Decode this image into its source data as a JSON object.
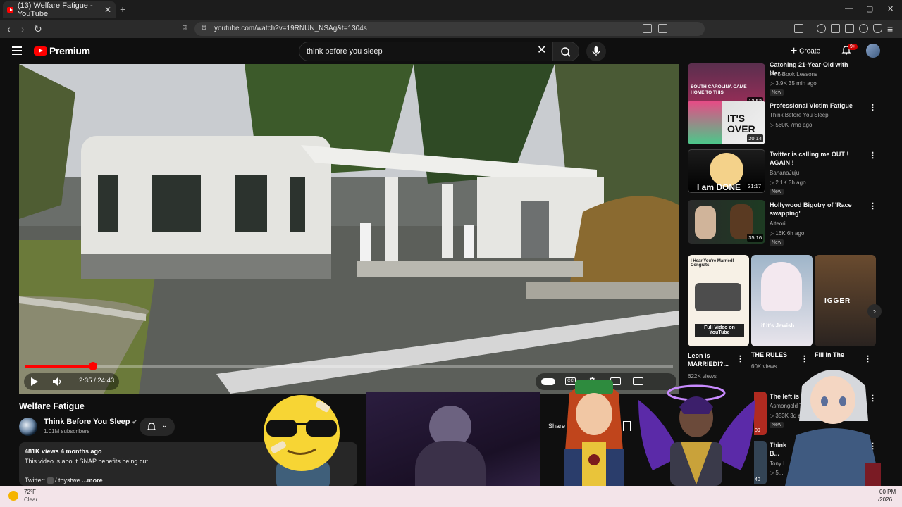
{
  "browser": {
    "tab_title": "(13) Welfare Fatigue - YouTube",
    "tab_close": "✕",
    "new_tab": "+",
    "url": "youtube.com/watch?v=19RNUN_NSAg&t=1304s",
    "window_controls": [
      "—",
      "▢",
      "✕"
    ]
  },
  "youtube_header": {
    "logo_text": "Premium",
    "search_query": "think before you sleep",
    "create_label": "Create",
    "notification_count": "9+"
  },
  "player": {
    "time": "2:35 / 24:43",
    "progress_fraction": 0.105
  },
  "video": {
    "title": "Welfare Fatigue",
    "channel": "Think Before You Sleep",
    "subscribers": "1.01M subscribers",
    "views_line": "481K views  4 months ago",
    "description": "This video is about SNAP benefits being cut.",
    "twitter_line": "Twitter:",
    "twitter_handle": "/ tbystwe",
    "more": "...more"
  },
  "overlay_labels": {
    "share": "Share"
  },
  "sidebar": {
    "videos": [
      {
        "title": "Catching 21-Year-Old with Her...",
        "channel": "Pink Book Lessons",
        "meta": "▷ 3.9K  35 min ago",
        "badge": "New",
        "duration": "12:53",
        "thumb_text": "SOUTH CAROLINA CAME HOME TO THIS"
      },
      {
        "title": "Professional Victim Fatigue",
        "channel": "Think Before You Sleep",
        "meta": "▷ 560K  7mo ago",
        "badge": "",
        "duration": "20:14",
        "thumb_text": "IT'S OVER"
      },
      {
        "title": "Twitter is calling me OUT ! AGAIN !",
        "channel": "BananaJuju",
        "meta": "▷ 2.1K  3h ago",
        "badge": "New",
        "duration": "31:17",
        "thumb_text": "I am DONE"
      },
      {
        "title": "Hollywood Bigotry of 'Race swapping'",
        "channel": "Alteori",
        "meta": "▷ 16K  6h ago",
        "badge": "New",
        "duration": "35:16",
        "thumb_text": ""
      }
    ],
    "shorts": [
      {
        "caption": "Leon is MARRIED!?...",
        "meta": "622K views",
        "thumb_top": "I Hear You're Married! Congrats!",
        "thumb_bottom": "Full Video on YouTube"
      },
      {
        "caption": "THE RULES",
        "meta": "60K views",
        "thumb_top": "",
        "thumb_bottom": "if it's Jewish"
      },
      {
        "caption": "Fill In The",
        "meta": "",
        "thumb_top": "IGGER",
        "thumb_bottom": ""
      }
    ],
    "lower": [
      {
        "title": "The left is ... BROKED...",
        "channel": "Asmongold TV",
        "meta": "▷ 353K  3d ago",
        "badge": "New",
        "duration": "09"
      },
      {
        "title": "Think B... Sams...",
        "channel": "Tony I",
        "meta": "▷ 5...",
        "badge": "",
        "duration": "40"
      }
    ]
  },
  "taskbar": {
    "temperature": "72°F",
    "condition": "Clear",
    "time": "00 PM",
    "date": "/2026"
  },
  "colors": {
    "youtube_red": "#ff0000",
    "bg": "#0f0f0f",
    "surface": "#272727"
  }
}
